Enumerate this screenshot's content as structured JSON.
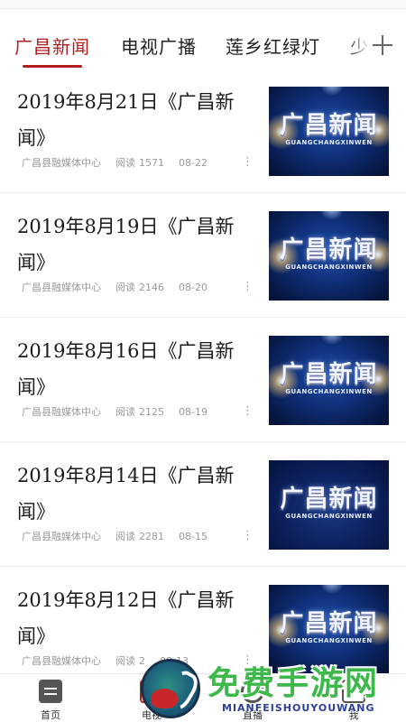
{
  "tabs": [
    {
      "label": "广昌新闻",
      "active": true
    },
    {
      "label": "电视广播",
      "active": false
    },
    {
      "label": "莲乡红绿灯",
      "active": false
    },
    {
      "label": "少",
      "active": false
    }
  ],
  "colors": {
    "accent": "#b51e1e",
    "meta_text": "#9a9a9a"
  },
  "thumbnail": {
    "text_cn": "广昌新闻",
    "text_en": "GUANGCHANGXINWEN"
  },
  "news": [
    {
      "title": "2019年8月21日《广昌新闻》",
      "source": "广昌县融媒体中心",
      "reads_label": "阅读",
      "reads": "1571",
      "date": "08-22",
      "more_icon": "⋮"
    },
    {
      "title": "2019年8月19日《广昌新闻》",
      "source": "广昌县融媒体中心",
      "reads_label": "阅读",
      "reads": "2146",
      "date": "08-20",
      "more_icon": "⋮"
    },
    {
      "title": "2019年8月16日《广昌新闻》",
      "source": "广昌县融媒体中心",
      "reads_label": "阅读",
      "reads": "2125",
      "date": "08-19",
      "more_icon": "⋮"
    },
    {
      "title": "2019年8月14日《广昌新闻》",
      "source": "广昌县融媒体中心",
      "reads_label": "阅读",
      "reads": "2281",
      "date": "08-15",
      "more_icon": "⋮"
    },
    {
      "title": "2019年8月12日《广昌新闻》",
      "source": "广昌县融媒体中心",
      "reads_label": "阅读",
      "reads": "2",
      "date": "08-13",
      "more_icon": "⋮"
    }
  ],
  "bottom_nav": [
    {
      "label": "首页",
      "icon": "home-icon"
    },
    {
      "label": "电视",
      "icon": "tv-icon"
    },
    {
      "label": "直播",
      "icon": "live-icon"
    },
    {
      "label": "我",
      "icon": "mine-icon"
    }
  ],
  "watermark": {
    "text_cn": "免费手游网",
    "text_en": "MIANFEISHOUYOUWANG"
  }
}
